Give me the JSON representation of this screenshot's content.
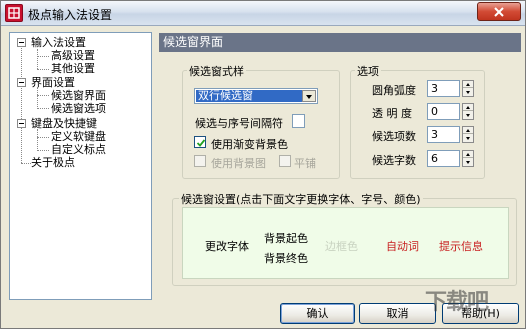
{
  "window": {
    "title": "极点输入法设置",
    "close_label": "close"
  },
  "tree": {
    "items": [
      {
        "label": "输入法设置",
        "level": 0,
        "expanded": true
      },
      {
        "label": "高级设置",
        "level": 1
      },
      {
        "label": "其他设置",
        "level": 1
      },
      {
        "label": "界面设置",
        "level": 0,
        "expanded": true
      },
      {
        "label": "候选窗界面",
        "level": 1,
        "selected": true
      },
      {
        "label": "候选窗选项",
        "level": 1
      },
      {
        "label": "键盘及快捷键",
        "level": 0,
        "expanded": true
      },
      {
        "label": "定义软键盘",
        "level": 1
      },
      {
        "label": "自定义标点",
        "level": 1
      },
      {
        "label": "关于极点",
        "level": 0
      }
    ]
  },
  "panel": {
    "header": "候选窗界面"
  },
  "style_group": {
    "title": "候选窗式样",
    "combo_value": "双行候选窗",
    "separator_label": "候选与序号间隔符",
    "gradient_label": "使用渐变背景色",
    "gradient_checked": true,
    "bgimage_label": "使用背景图",
    "bgimage_checked": false,
    "tile_label": "平铺",
    "tile_checked": false
  },
  "options_group": {
    "title": "选项",
    "fields": [
      {
        "label": "圆角弧度",
        "value": "3"
      },
      {
        "label": "透 明 度",
        "value": "0"
      },
      {
        "label": "候选项数",
        "value": "3"
      },
      {
        "label": "候选字数",
        "value": "6"
      }
    ]
  },
  "settings_group": {
    "title": "候选窗设置(点击下面文字更换字体、字号、颜色)",
    "change_font": "更改字体",
    "bg_start": "背景起色",
    "bg_end": "背景终色",
    "border_color": "边框色",
    "auto_word": "自动词",
    "hint_info": "提示信息"
  },
  "colors": {
    "header_bg": "#6a7488",
    "selection": "#316ac5",
    "auto_word": "#c81e1e",
    "hint_info": "#c81e1e",
    "border_color_text": "#c8d2c0",
    "preview_bg": "#f0fce8"
  },
  "buttons": {
    "ok": "确认",
    "cancel": "取消",
    "help": "帮助(H)"
  },
  "watermark": "下载吧"
}
